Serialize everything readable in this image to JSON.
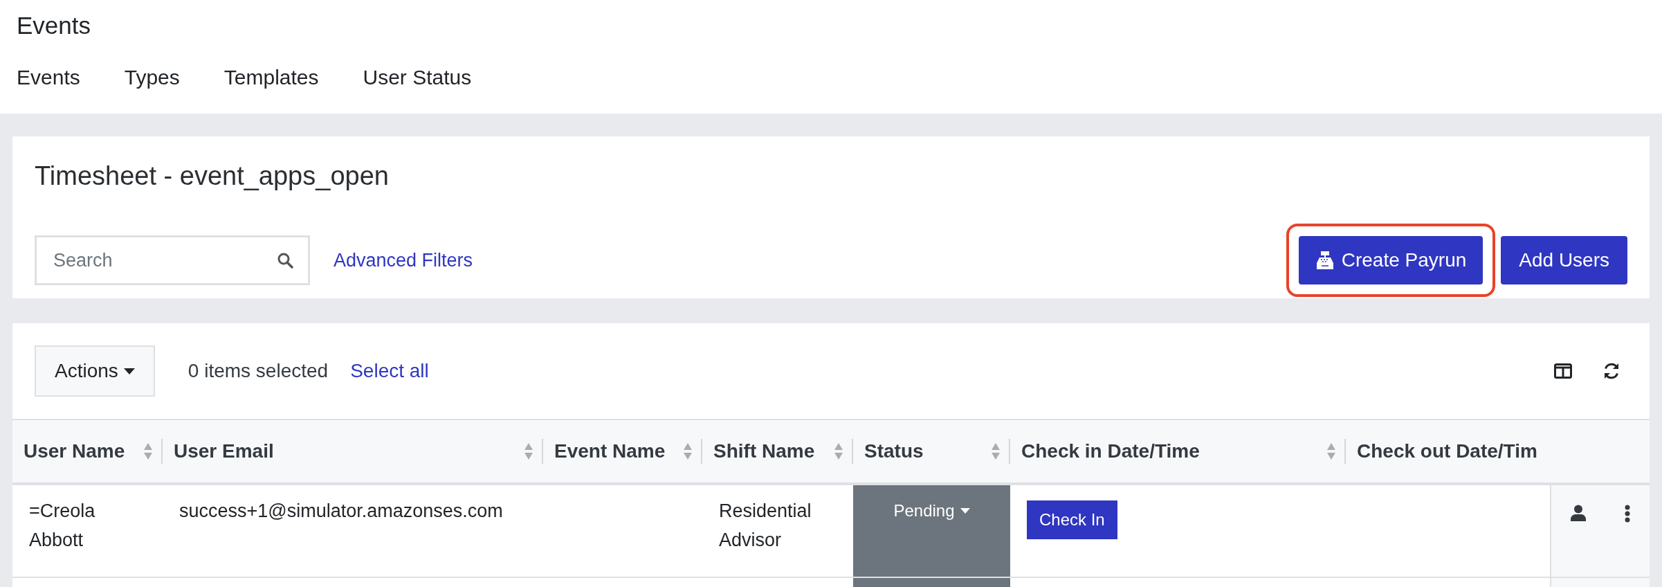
{
  "page_title": "Events",
  "tabs": [
    {
      "label": "Events"
    },
    {
      "label": "Types"
    },
    {
      "label": "Templates"
    },
    {
      "label": "User Status"
    }
  ],
  "panel": {
    "title": "Timesheet - event_apps_open",
    "search": {
      "placeholder": "Search"
    },
    "filters_link": "Advanced Filters",
    "highlighted_button": "Create Payrun",
    "button": "Add Users"
  },
  "toolbar": {
    "actions": "Actions",
    "selection_count": "0 items selected",
    "select_all": "Select all"
  },
  "table": {
    "columns": [
      {
        "label": "User Name",
        "sortable": true
      },
      {
        "label": "User Email",
        "sortable": true
      },
      {
        "label": "Event Name",
        "sortable": true
      },
      {
        "label": "Shift Name",
        "sortable": true
      },
      {
        "label": "Status",
        "sortable": true
      },
      {
        "label": "Check in Date/Time",
        "sortable": true
      },
      {
        "label": "Check out Date/Tim",
        "sortable": false
      }
    ],
    "rows": [
      {
        "user_name": "=Creola Abbott",
        "email": "success+1@simulator.amazonses.com",
        "event_name": "",
        "shift_name": "Residential Advisor",
        "status": "Pending",
        "check_in": "Check In"
      }
    ]
  }
}
